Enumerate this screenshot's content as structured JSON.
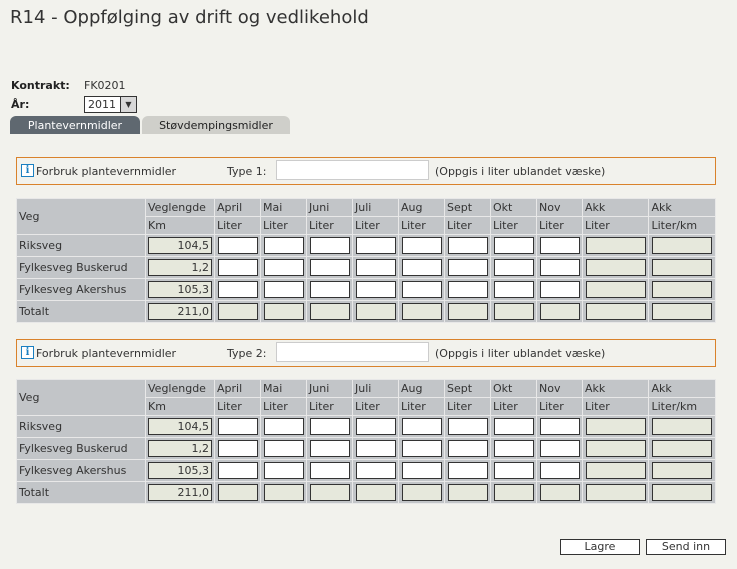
{
  "title": "R14 - Oppfølging av drift og vedlikehold",
  "contract": {
    "label": "Kontrakt:",
    "value": "FK0201"
  },
  "year": {
    "label": "År:",
    "value": "2011",
    "icon": "chevron-down-icon"
  },
  "tabs": [
    {
      "label": "Plantevernmidler",
      "active": true
    },
    {
      "label": "Støvdempingsmidler",
      "active": false
    }
  ],
  "sections": [
    {
      "forbruk_label": "Forbruk plantevernmidler",
      "type_label": "Type 1:",
      "type_value": "",
      "hint": "(Oppgis i liter ublandet væske)",
      "table": {
        "header_row1": [
          "Veg",
          "Veglengde",
          "April",
          "Mai",
          "Juni",
          "Juli",
          "Aug",
          "Sept",
          "Okt",
          "Nov",
          "Akk",
          "Akk"
        ],
        "header_row2": [
          "Km",
          "Liter",
          "Liter",
          "Liter",
          "Liter",
          "Liter",
          "Liter",
          "Liter",
          "Liter",
          "Liter",
          "Liter/km"
        ],
        "rows": [
          {
            "veg": "Riksveg",
            "km": "104,5"
          },
          {
            "veg": "Fylkesveg Buskerud",
            "km": "1,2"
          },
          {
            "veg": "Fylkesveg Akershus",
            "km": "105,3"
          },
          {
            "veg": "Totalt",
            "km": "211,0"
          }
        ]
      }
    },
    {
      "forbruk_label": "Forbruk plantevernmidler",
      "type_label": "Type 2:",
      "type_value": "",
      "hint": "(Oppgis i liter ublandet væske)",
      "table": {
        "header_row1": [
          "Veg",
          "Veglengde",
          "April",
          "Mai",
          "Juni",
          "Juli",
          "Aug",
          "Sept",
          "Okt",
          "Nov",
          "Akk",
          "Akk"
        ],
        "header_row2": [
          "Km",
          "Liter",
          "Liter",
          "Liter",
          "Liter",
          "Liter",
          "Liter",
          "Liter",
          "Liter",
          "Liter",
          "Liter/km"
        ],
        "rows": [
          {
            "veg": "Riksveg",
            "km": "104,5"
          },
          {
            "veg": "Fylkesveg Buskerud",
            "km": "1,2"
          },
          {
            "veg": "Fylkesveg Akershus",
            "km": "105,3"
          },
          {
            "veg": "Totalt",
            "km": "211,0"
          }
        ]
      }
    }
  ],
  "buttons": {
    "save": "Lagre",
    "submit": "Send inn"
  },
  "colors": {
    "accent_border": "#d9822b",
    "tab_active": "#5f6870",
    "table_bg": "#c2c5c8",
    "readonly_bg": "#e6e8dc"
  }
}
